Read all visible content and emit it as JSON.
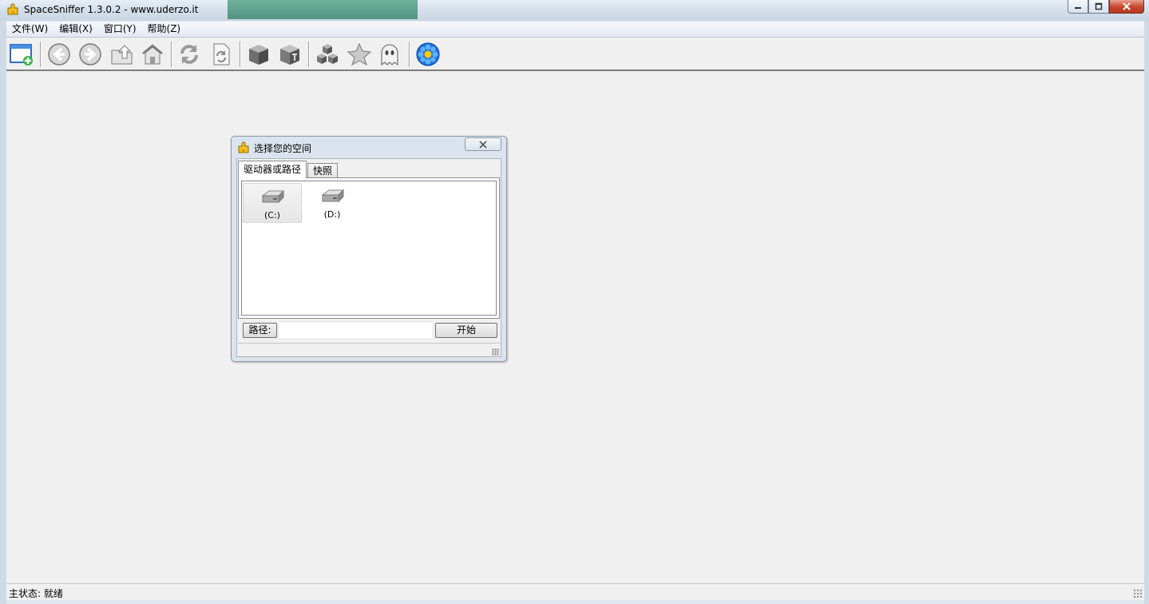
{
  "window": {
    "title": "SpaceSniffer 1.3.0.2 - www.uderzo.it",
    "buttons": {
      "minimize_icon": "minimize-icon",
      "maximize_icon": "restore-icon",
      "close_icon": "close-icon"
    }
  },
  "menu": {
    "items": [
      {
        "label": "文件(W)"
      },
      {
        "label": "编辑(X)"
      },
      {
        "label": "窗口(Y)"
      },
      {
        "label": "帮助(Z)"
      }
    ]
  },
  "toolbar": {
    "buttons": [
      {
        "icon": "new-window-icon"
      },
      {
        "icon": "back-arrow-icon"
      },
      {
        "icon": "forward-arrow-icon"
      },
      {
        "icon": "up-folder-icon"
      },
      {
        "icon": "home-icon"
      },
      {
        "icon": "refresh-icon"
      },
      {
        "icon": "refresh-document-icon"
      },
      {
        "icon": "cube-icon"
      },
      {
        "icon": "tagged-cube-icon"
      },
      {
        "icon": "multi-cube-icon"
      },
      {
        "icon": "star-icon"
      },
      {
        "icon": "ghost-icon"
      },
      {
        "icon": "blue-flower-icon"
      }
    ]
  },
  "status": {
    "text": "主状态: 就绪"
  },
  "dialog": {
    "title": "选择您的空间",
    "tabs": [
      {
        "label": "驱动器或路径",
        "active": true
      },
      {
        "label": "快照",
        "active": false
      }
    ],
    "drives": [
      {
        "label": "(C:)",
        "selected": true
      },
      {
        "label": "(D:)",
        "selected": false
      }
    ],
    "path_label": "路径:",
    "path_value": "",
    "start_label": "开始"
  },
  "colors": {
    "title_bar": "#d6e0ec",
    "close_button": "#c7452d",
    "workspace": "#f0f0f0",
    "dialog_frame": "#dbe4ee"
  }
}
